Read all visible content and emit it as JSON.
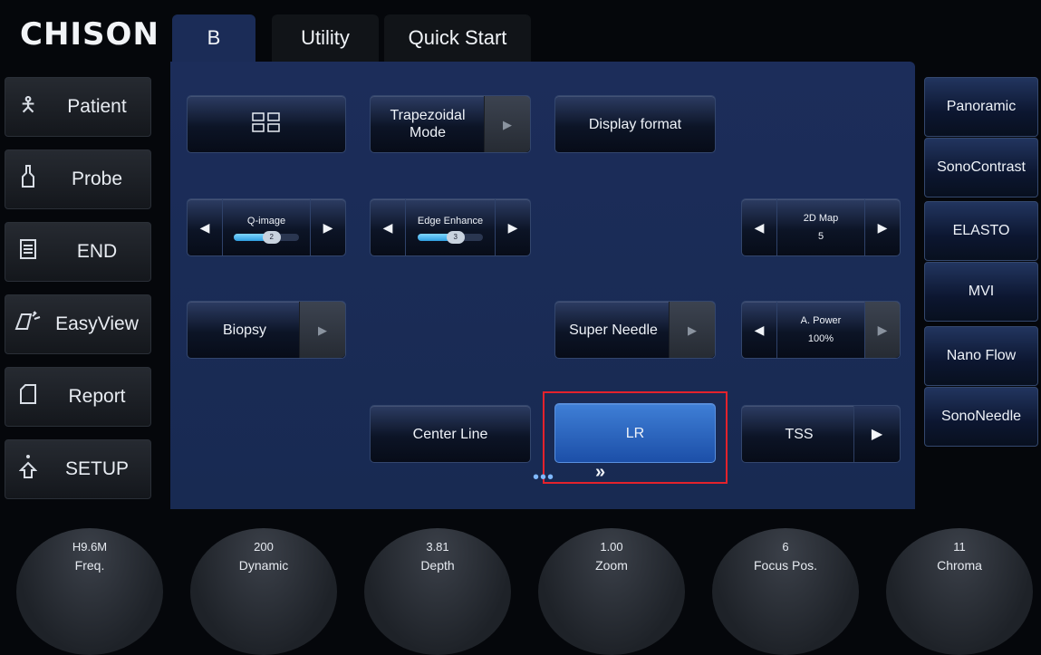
{
  "brand": "CHISON",
  "tabs": [
    {
      "label": "B",
      "active": true
    },
    {
      "label": "Utility",
      "active": false
    },
    {
      "label": "Quick Start",
      "active": false
    }
  ],
  "sidebar": [
    {
      "label": "Patient",
      "icon": "person-icon"
    },
    {
      "label": "Probe",
      "icon": "probe-icon"
    },
    {
      "label": "END",
      "icon": "end-exam-icon"
    },
    {
      "label": "EasyView",
      "icon": "easyview-icon"
    },
    {
      "label": "Report",
      "icon": "report-icon"
    },
    {
      "label": "SETUP",
      "icon": "setup-icon"
    }
  ],
  "main": {
    "layout_button": {
      "icon": "grid-layout-icon"
    },
    "trapezoidal": {
      "label": "Trapezoidal Mode"
    },
    "display_format": {
      "label": "Display format"
    },
    "q_image": {
      "label": "Q-image",
      "value": "2",
      "level": 0.58
    },
    "edge_enhance": {
      "label": "Edge Enhance",
      "value": "3",
      "level": 0.58
    },
    "map_2d": {
      "label": "2D Map",
      "value": "5"
    },
    "biopsy": {
      "label": "Biopsy"
    },
    "super_needle": {
      "label": "Super Needle"
    },
    "a_power": {
      "label": "A. Power",
      "value": "100%"
    },
    "center_line": {
      "label": "Center Line"
    },
    "lr": {
      "label": "LR"
    },
    "tss": {
      "label": "TSS"
    },
    "page_dots": "•••",
    "next_page": "»"
  },
  "right_panel": [
    {
      "label": "Panoramic"
    },
    {
      "label": "SonoContrast"
    },
    {
      "label": "ELASTO"
    },
    {
      "label": "MVI"
    },
    {
      "label": "Nano Flow"
    },
    {
      "label": "SonoNeedle"
    }
  ],
  "knobs": [
    {
      "value": "H9.6M",
      "name": "Freq."
    },
    {
      "value": "200",
      "name": "Dynamic"
    },
    {
      "value": "3.81",
      "name": "Depth"
    },
    {
      "value": "1.00",
      "name": "Zoom"
    },
    {
      "value": "6",
      "name": "Focus Pos."
    },
    {
      "value": "11",
      "name": "Chroma"
    }
  ],
  "colors": {
    "panel": "#1b2c57",
    "highlight": "#e3222c",
    "lr_active": "#2f68c4"
  }
}
